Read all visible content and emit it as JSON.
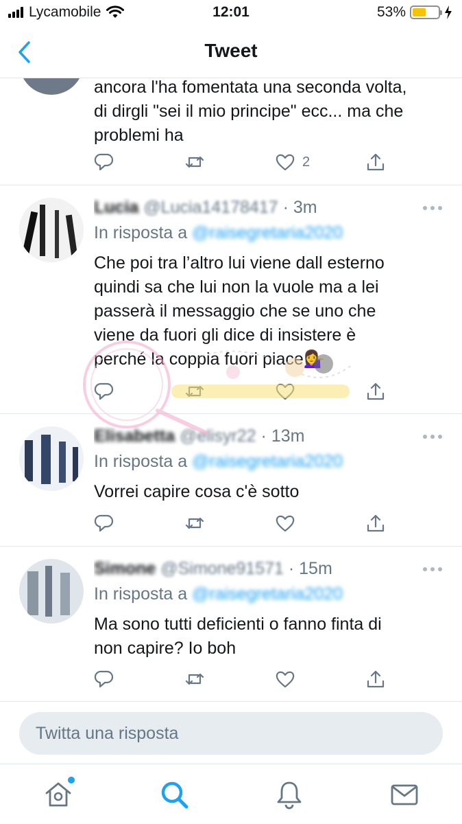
{
  "status_bar": {
    "carrier": "Lycamobile",
    "time": "12:01",
    "battery_percent": "53%",
    "battery_level": 0.53
  },
  "nav": {
    "title": "Tweet"
  },
  "tweets": [
    {
      "text_lines": [
        "ancora l'ha fomentata una seconda volta,",
        "di dirgli \"sei il mio principe\" ecc... ma che",
        "problemi ha"
      ],
      "likes": "2"
    },
    {
      "name": "Lucia",
      "handle": "@Lucia14178417",
      "time": "· 3m",
      "reply_prefix": "In risposta a",
      "mention": "@raisegretaria2020",
      "text_lines": [
        "Che poi tra l’altro lui viene dall esterno",
        "quindi sa che lui non la vuole ma a lei",
        "passerà il messaggio che se uno che",
        "viene da fuori gli dice di insistere è",
        "perché la coppia fuori piace💁‍♀️"
      ]
    },
    {
      "name": "Elisabetta",
      "handle": "@elisyr22",
      "time": "· 13m",
      "reply_prefix": "In risposta a",
      "mention": "@raisegretaria2020",
      "text_lines": [
        "Vorrei capire cosa c'è sotto"
      ]
    },
    {
      "name": "Simone",
      "handle": "@Simone91571",
      "time": "· 15m",
      "reply_prefix": "In risposta a",
      "mention": "@raisegretaria2020",
      "text_lines": [
        "Ma sono tutti deficienti o fanno finta di",
        "non capire? Io boh"
      ]
    }
  ],
  "reply_bar": {
    "placeholder": "Twitta una risposta"
  },
  "tabs": [
    {
      "icon": "home-icon"
    },
    {
      "icon": "search-icon"
    },
    {
      "icon": "bell-icon"
    },
    {
      "icon": "mail-icon"
    }
  ],
  "colors": {
    "accent": "#1da1f2",
    "muted": "#657786",
    "text": "#14171a",
    "battery": "#f5c400"
  }
}
